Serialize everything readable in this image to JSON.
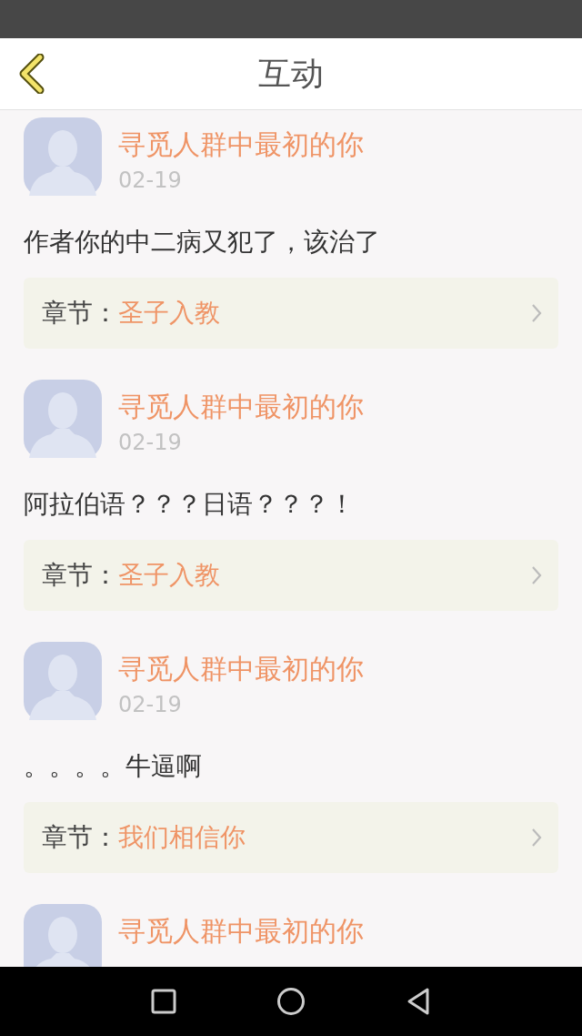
{
  "header": {
    "title": "互动"
  },
  "comments": [
    {
      "author": "寻觅人群中最初的你",
      "date": "02-19",
      "text": "作者你的中二病又犯了，该治了",
      "chapter_label": "章节：",
      "chapter": "圣子入教"
    },
    {
      "author": "寻觅人群中最初的你",
      "date": "02-19",
      "text": "阿拉伯语？？？日语？？？！",
      "chapter_label": "章节：",
      "chapter": "圣子入教"
    },
    {
      "author": "寻觅人群中最初的你",
      "date": "02-19",
      "text": "。。。。牛逼啊",
      "chapter_label": "章节：",
      "chapter": "我们相信你"
    },
    {
      "author": "寻觅人群中最初的你"
    }
  ]
}
